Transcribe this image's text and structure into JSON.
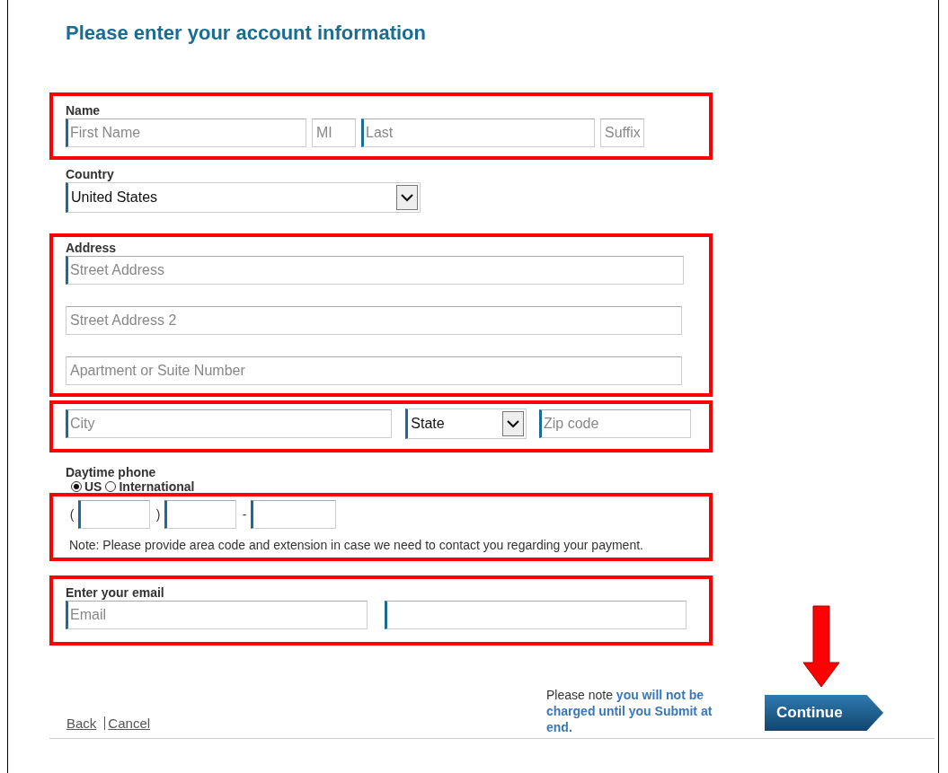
{
  "title": "Please enter your account information",
  "groups": [
    {
      "kind": "fields",
      "label": "Name",
      "highlighted": true,
      "rows": [
        [
          {
            "kind": "text",
            "placeholder": "First Name",
            "required": true
          },
          {
            "kind": "text",
            "placeholder": "MI",
            "required": false
          },
          {
            "kind": "text",
            "placeholder": "Last",
            "required": true
          },
          {
            "kind": "text",
            "placeholder": "Suffix",
            "required": false
          }
        ]
      ]
    },
    {
      "kind": "fields",
      "label": "Country",
      "highlighted": false,
      "rows": [
        [
          {
            "kind": "select",
            "value": "United States",
            "required": true
          }
        ]
      ]
    },
    {
      "kind": "fields",
      "label": "Address",
      "highlighted": true,
      "rows": [
        [
          {
            "kind": "text",
            "placeholder": "Street Address",
            "required": true
          }
        ],
        [
          {
            "kind": "text",
            "placeholder": "Street Address 2",
            "required": false
          }
        ],
        [
          {
            "kind": "text",
            "placeholder": "Apartment or Suite Number",
            "required": false
          }
        ]
      ]
    },
    {
      "kind": "fields",
      "highlighted": true,
      "rows": [
        [
          {
            "kind": "text",
            "placeholder": "City",
            "required": true
          },
          {
            "kind": "select",
            "value": "State",
            "required": true
          },
          {
            "kind": "text",
            "placeholder": "Zip code",
            "required": true
          }
        ]
      ]
    },
    {
      "kind": "phone",
      "label": "Daytime phone",
      "options": [
        {
          "label": "US",
          "selected": true
        },
        {
          "label": "International",
          "selected": false
        }
      ],
      "highlighted": true,
      "parts": [
        {
          "prefix": "(",
          "required": true
        },
        {
          "prefix": ")",
          "required": true
        },
        {
          "prefix": "-",
          "required": true
        }
      ],
      "note": "Note: Please provide area code and extension in case we need to contact you regarding your payment."
    },
    {
      "kind": "fields",
      "label": "Enter your email",
      "highlighted": true,
      "rows": [
        [
          {
            "kind": "text",
            "placeholder": "Email",
            "required": true
          },
          {
            "kind": "text",
            "required": true
          }
        ]
      ]
    }
  ],
  "footer": {
    "links": [
      "Back",
      "Cancel"
    ],
    "note": "Please note **you will not be charged until you Submit at end.**",
    "button": "Continue",
    "pointer_arrow": true
  }
}
